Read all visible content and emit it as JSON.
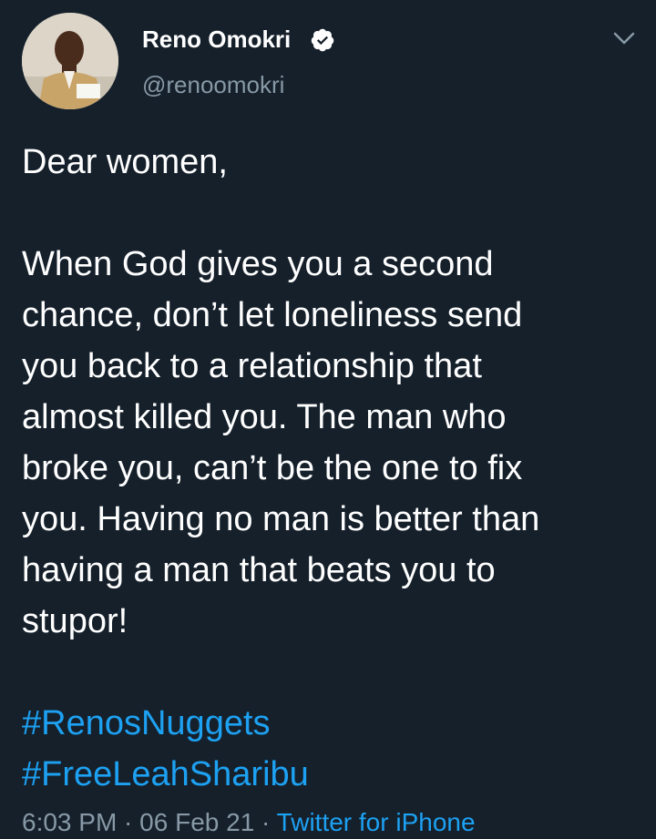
{
  "author": {
    "display_name": "Reno Omokri",
    "handle": "@renoomokri",
    "verified": true
  },
  "tweet": {
    "greeting": "Dear women,",
    "body": "When God gives you a second\nchance, don’t let loneliness send\nyou back to a relationship that\nalmost killed you. The man who\nbroke you, can’t be the one to fix\nyou. Having no man is better than\nhaving a man that beats you to\nstupor!",
    "hashtags": [
      "#RenosNuggets",
      "#FreeLeahSharibu"
    ]
  },
  "meta": {
    "time": "6:03 PM",
    "separator": " · ",
    "date": "06 Feb 21",
    "source": "Twitter for iPhone"
  },
  "colors": {
    "background": "#15202b",
    "text": "#ffffff",
    "secondary": "#8899a6",
    "accent": "#1da1f2"
  },
  "icons": {
    "verified": "verified-badge-icon",
    "menu": "chevron-down-icon"
  }
}
